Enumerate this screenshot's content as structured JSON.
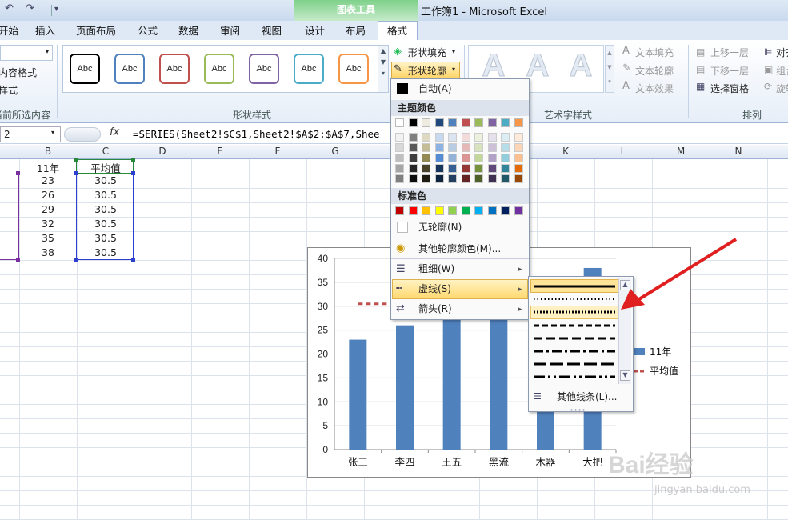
{
  "window": {
    "title": "工作簿1 - Microsoft Excel",
    "context_tab_title": "图表工具"
  },
  "tabs": [
    "开始",
    "插入",
    "页面布局",
    "公式",
    "数据",
    "审阅",
    "视图",
    "设计",
    "布局",
    "格式"
  ],
  "ribbon": {
    "left_items": [
      "内容格式",
      "样式"
    ],
    "group_left_label": "当前所选内容",
    "style_label": "Abc",
    "style_colors": [
      "#000000",
      "#4f81bd",
      "#c0504d",
      "#9bbb59",
      "#8064a2",
      "#4bacc6",
      "#f79646"
    ],
    "shape_fill": "形状填充",
    "shape_outline": "形状轮廓",
    "shape_styles_label": "形状样式",
    "wordart_glyph": "A",
    "text_fill": "文本填充",
    "text_outline": "文本轮廓",
    "text_effect": "文本效果",
    "wordart_label": "艺术字样式",
    "bring_forward": "上移一层",
    "send_backward": "下移一层",
    "selection_pane": "选择窗格",
    "align": "对齐",
    "group": "组合",
    "rotate": "旋转",
    "arrange_label": "排列"
  },
  "formula_bar": {
    "name_box": "2",
    "fx": "fx",
    "formula": "=SERIES(Sheet2!$C$1,Sheet2!$A$2:$A$7,Shee"
  },
  "columns": [
    "B",
    "C",
    "D",
    "E",
    "F",
    "G",
    "H",
    "I",
    "J",
    "K",
    "L",
    "M",
    "N"
  ],
  "sheet": {
    "header_b": "11年",
    "header_c": "平均值",
    "values_b": [
      "23",
      "26",
      "29",
      "32",
      "35",
      "38"
    ],
    "values_c": [
      "30.5",
      "30.5",
      "30.5",
      "30.5",
      "30.5",
      "30.5"
    ]
  },
  "chart_data": {
    "type": "bar",
    "categories": [
      "张三",
      "李四",
      "王五",
      "黑流",
      "木器",
      "大把"
    ],
    "series": [
      {
        "name": "11年",
        "type": "bar",
        "values": [
          23,
          26,
          29,
          32,
          35,
          38
        ],
        "color": "#4f81bd"
      },
      {
        "name": "平均值",
        "type": "line",
        "values": [
          30.5,
          30.5,
          30.5,
          30.5,
          30.5,
          30.5
        ],
        "color": "#c0504d",
        "dash": "dashed"
      }
    ],
    "ylim": [
      0,
      40
    ],
    "yticks": [
      "0",
      "5",
      "10",
      "15",
      "20",
      "25",
      "30",
      "35",
      "40"
    ],
    "grid": true,
    "legend": "right"
  },
  "outline_menu": {
    "auto": "自动(A)",
    "theme_colors_label": "主题颜色",
    "standard_colors_label": "标准色",
    "no_outline": "无轮廓(N)",
    "more_colors": "其他轮廓颜色(M)...",
    "weight": "粗细(W)",
    "dashes": "虚线(S)",
    "arrows": "箭头(R)",
    "theme_top": [
      "#ffffff",
      "#000000",
      "#eeece1",
      "#1f497d",
      "#4f81bd",
      "#c0504d",
      "#9bbb59",
      "#8064a2",
      "#4bacc6",
      "#f79646"
    ],
    "standard": [
      "#c00000",
      "#ff0000",
      "#ffc000",
      "#ffff00",
      "#92d050",
      "#00b050",
      "#00b0f0",
      "#0070c0",
      "#002060",
      "#7030a0"
    ]
  },
  "dash_submenu": {
    "more_lines": "其他线条(L)..."
  },
  "watermark": {
    "brand": "Bai经验",
    "url": "jingyan.baidu.com"
  }
}
